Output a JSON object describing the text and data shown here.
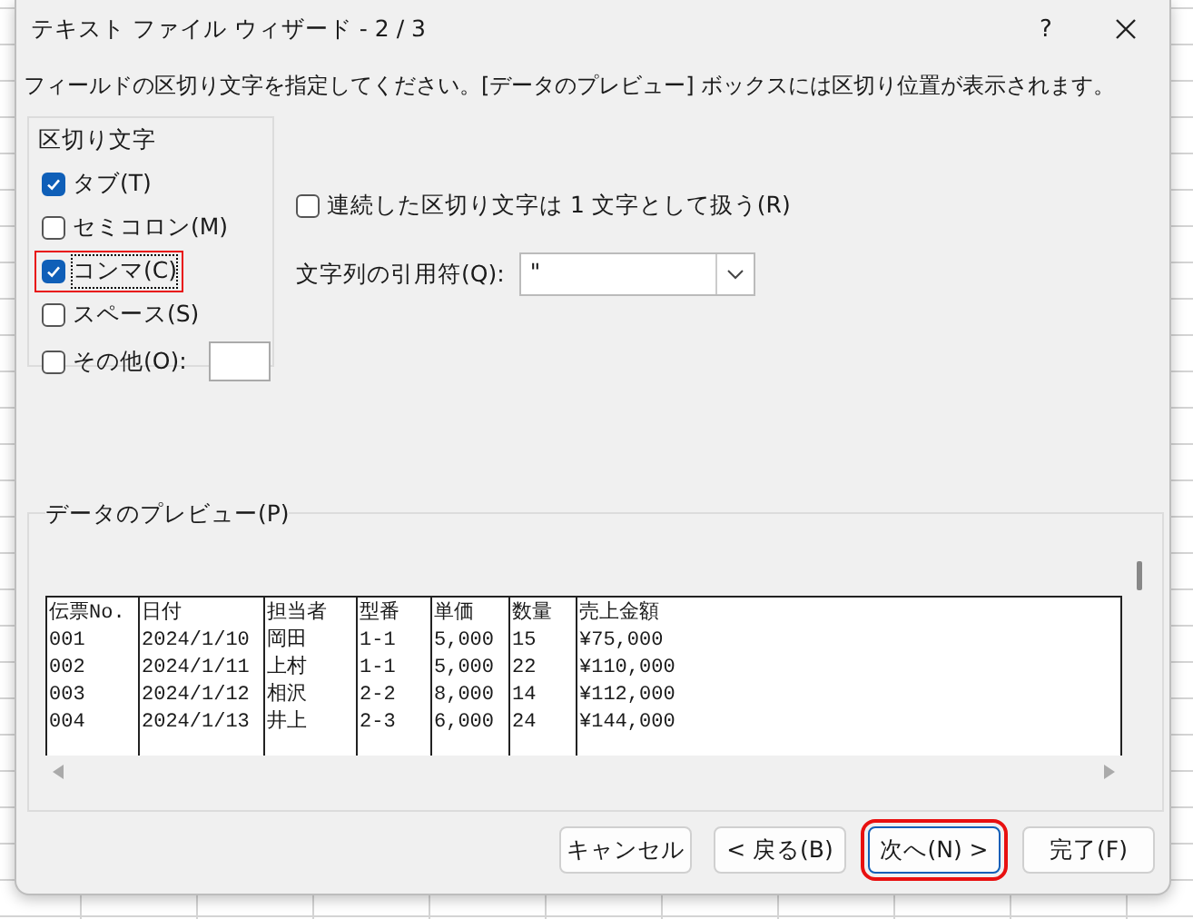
{
  "window": {
    "title": "テキスト ファイル ウィザード - 2 / 3",
    "help": "?"
  },
  "instruction": "フィールドの区切り文字を指定してください。[データのプレビュー] ボックスには区切り位置が表示されます。",
  "delimiters": {
    "label": "区切り文字",
    "options": [
      {
        "kind": "plain",
        "label": "タブ(T)",
        "checked": true,
        "highlighted": false
      },
      {
        "kind": "plain",
        "label": "セミコロン(M)",
        "checked": false,
        "highlighted": false
      },
      {
        "kind": "plain",
        "label": "コンマ(C)",
        "checked": true,
        "highlighted": true
      },
      {
        "kind": "plain",
        "label": "スペース(S)",
        "checked": false,
        "highlighted": false
      },
      {
        "kind": "with-field",
        "label": "その他(O):",
        "checked": false,
        "highlighted": false
      }
    ]
  },
  "consecutive": {
    "label": "連続した区切り文字は 1 文字として扱う(R)",
    "checked": false
  },
  "text_qualifier": {
    "label": "文字列の引用符(Q):",
    "value": "\""
  },
  "preview": {
    "label": "データのプレビュー(P)",
    "rows": [
      [
        "伝票No.",
        "日付",
        "担当者",
        "型番",
        "単価",
        "数量",
        "売上金額"
      ],
      [
        "001",
        "2024/1/10",
        "岡田",
        "1-1",
        "5,000",
        "15",
        "¥75,000"
      ],
      [
        "002",
        "2024/1/11",
        "上村",
        "1-1",
        "5,000",
        "22",
        "¥110,000"
      ],
      [
        "003",
        "2024/1/12",
        "相沢",
        "2-2",
        "8,000",
        "14",
        "¥112,000"
      ],
      [
        "004",
        "2024/1/13",
        "井上",
        "2-3",
        "6,000",
        "24",
        "¥144,000"
      ]
    ]
  },
  "buttons": [
    {
      "label": "キャンセル",
      "highlighted": false
    },
    {
      "label": "< 戻る(B)",
      "highlighted": false
    },
    {
      "label": "次へ(N) >",
      "highlighted": true
    },
    {
      "label": "完了(F)",
      "highlighted": false
    }
  ]
}
